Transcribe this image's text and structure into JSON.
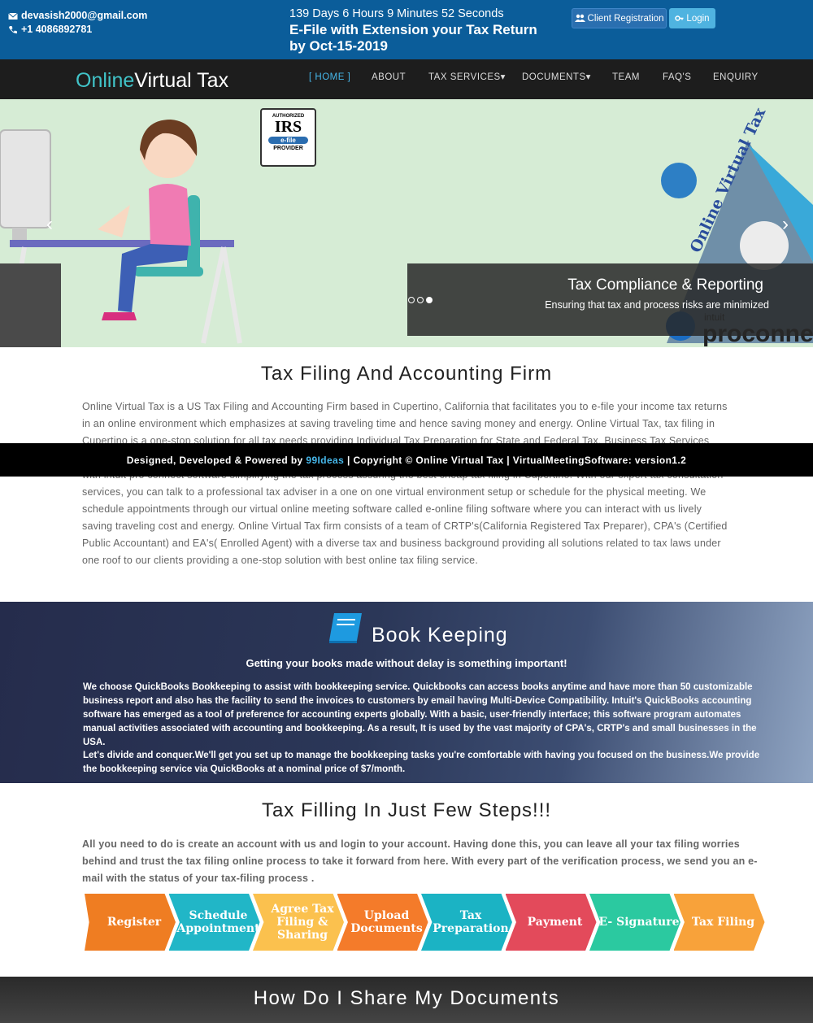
{
  "topbar": {
    "email": "devasish2000@gmail.com",
    "phone": "+1 4086892781",
    "countdown": "139 Days 6 Hours 9 Minutes 52 Seconds",
    "headline_1": "E-File with Extension your Tax Return",
    "headline_2": "by Oct-15-2019",
    "client_registration": "Client Registration",
    "login": "Login"
  },
  "nav": {
    "logo_part1": "Online",
    "logo_part2": "Virtual Tax",
    "items": [
      "[ HOME ]",
      "ABOUT",
      "TAX SERVICES▾",
      "DOCUMENTS▾",
      "TEAM",
      "FAQ'S",
      "ENQUIRY"
    ]
  },
  "hero": {
    "irs_badge": [
      "AUTHORIZED",
      "IRS",
      "e-file",
      "PROVIDER"
    ],
    "caption_title": "Tax Compliance & Reporting",
    "caption_sub": "Ensuring that tax and process risks are minimized",
    "slides": 3,
    "active_slide": 3,
    "decor_text_1": "Online Virtual Tax",
    "decor_text_2": "intuit",
    "decor_text_3": "proconne"
  },
  "about": {
    "title": "Tax Filing And Accounting Firm",
    "text": "Online Virtual Tax is a US Tax Filing and Accounting Firm based in Cupertino, California that facilitates you to e-file your income tax returns in an online environment which emphasizes at saving traveling time and hence saving money and energy. Online Virtual Tax, tax filing in Cupertino is a one-stop solution for all tax needs providing Individual Tax Preparation for State and Federal Tax, Business Tax Services providing the best online tax filing in Cupertino with 1 or 0 visits. Online Virtual Tax is a certified IRS approved E-file provider joining hands with intuit pro connect software simplifying the tax process assuring the best cheap tax filing in Cupertino. With our expert tax consultation services, you can talk to a professional tax adviser in a one on one virtual environment setup or schedule for the physical meeting. We schedule appointments through our virtual online meeting software called e-online filing software where you can interact with us lively saving traveling cost and energy. Online Virtual Tax firm consists of a team of CRTP's(California Registered Tax Preparer), CPA's (Certified Public Accountant) and EA's( Enrolled Agent) with a diverse tax and business background providing all solutions related to tax laws under one roof to our clients providing a one-stop solution with best online tax filing service."
  },
  "footer_strip": {
    "prefix": "Designed, Developed & Powered by ",
    "brand": "99Ideas",
    "suffix": " | Copyright © Online Virtual Tax | VirtualMeetingSoftware: version1.2"
  },
  "bookkeeping": {
    "title": "Book Keeping",
    "subtitle": "Getting your books made without delay is something important!",
    "p1": "We choose QuickBooks Bookkeeping to assist with bookkeeping service. Quickbooks can access books anytime and have more than 50 customizable business report and also has the facility to send the invoices to customers by email having Multi-Device Compatibility. Intuit's QuickBooks accounting software has emerged as a tool of preference for accounting experts globally. With a basic, user-friendly interface; this software program automates manual activities associated with accounting and bookkeeping. As a result, It is used by the vast majority of CPA's, CRTP's and small businesses in the USA.",
    "p2": "Let's divide and conquer.We'll get you set up to manage the bookkeeping tasks you're comfortable with having you focused on the business.We provide the bookkeeping service via QuickBooks at a nominal price of $7/month."
  },
  "steps": {
    "title": "Tax Filling In Just Few Steps!!!",
    "text": "All you need to do is create an account with us and login to your account. Having done this, you can leave all your tax filing worries behind and trust the tax filing online process to take it forward from here. With every part of the verification process, we send you an e-mail with the status of your tax-filing process .",
    "items": [
      {
        "label": "Register",
        "color": "#ef7d22"
      },
      {
        "label": "Schedule Appointment",
        "color": "#21b6c7"
      },
      {
        "label": "Agree Tax Filing & Sharing",
        "color": "#fbc14e"
      },
      {
        "label": "Upload Documents",
        "color": "#f47b2a"
      },
      {
        "label": "Tax Preparation",
        "color": "#1bb3c4"
      },
      {
        "label": "Payment",
        "color": "#e34a5b"
      },
      {
        "label": "E- Signature",
        "color": "#2bc9a0"
      },
      {
        "label": "Tax Filing",
        "color": "#f8a23a"
      }
    ]
  },
  "share": {
    "title": "How Do I Share My Documents"
  }
}
